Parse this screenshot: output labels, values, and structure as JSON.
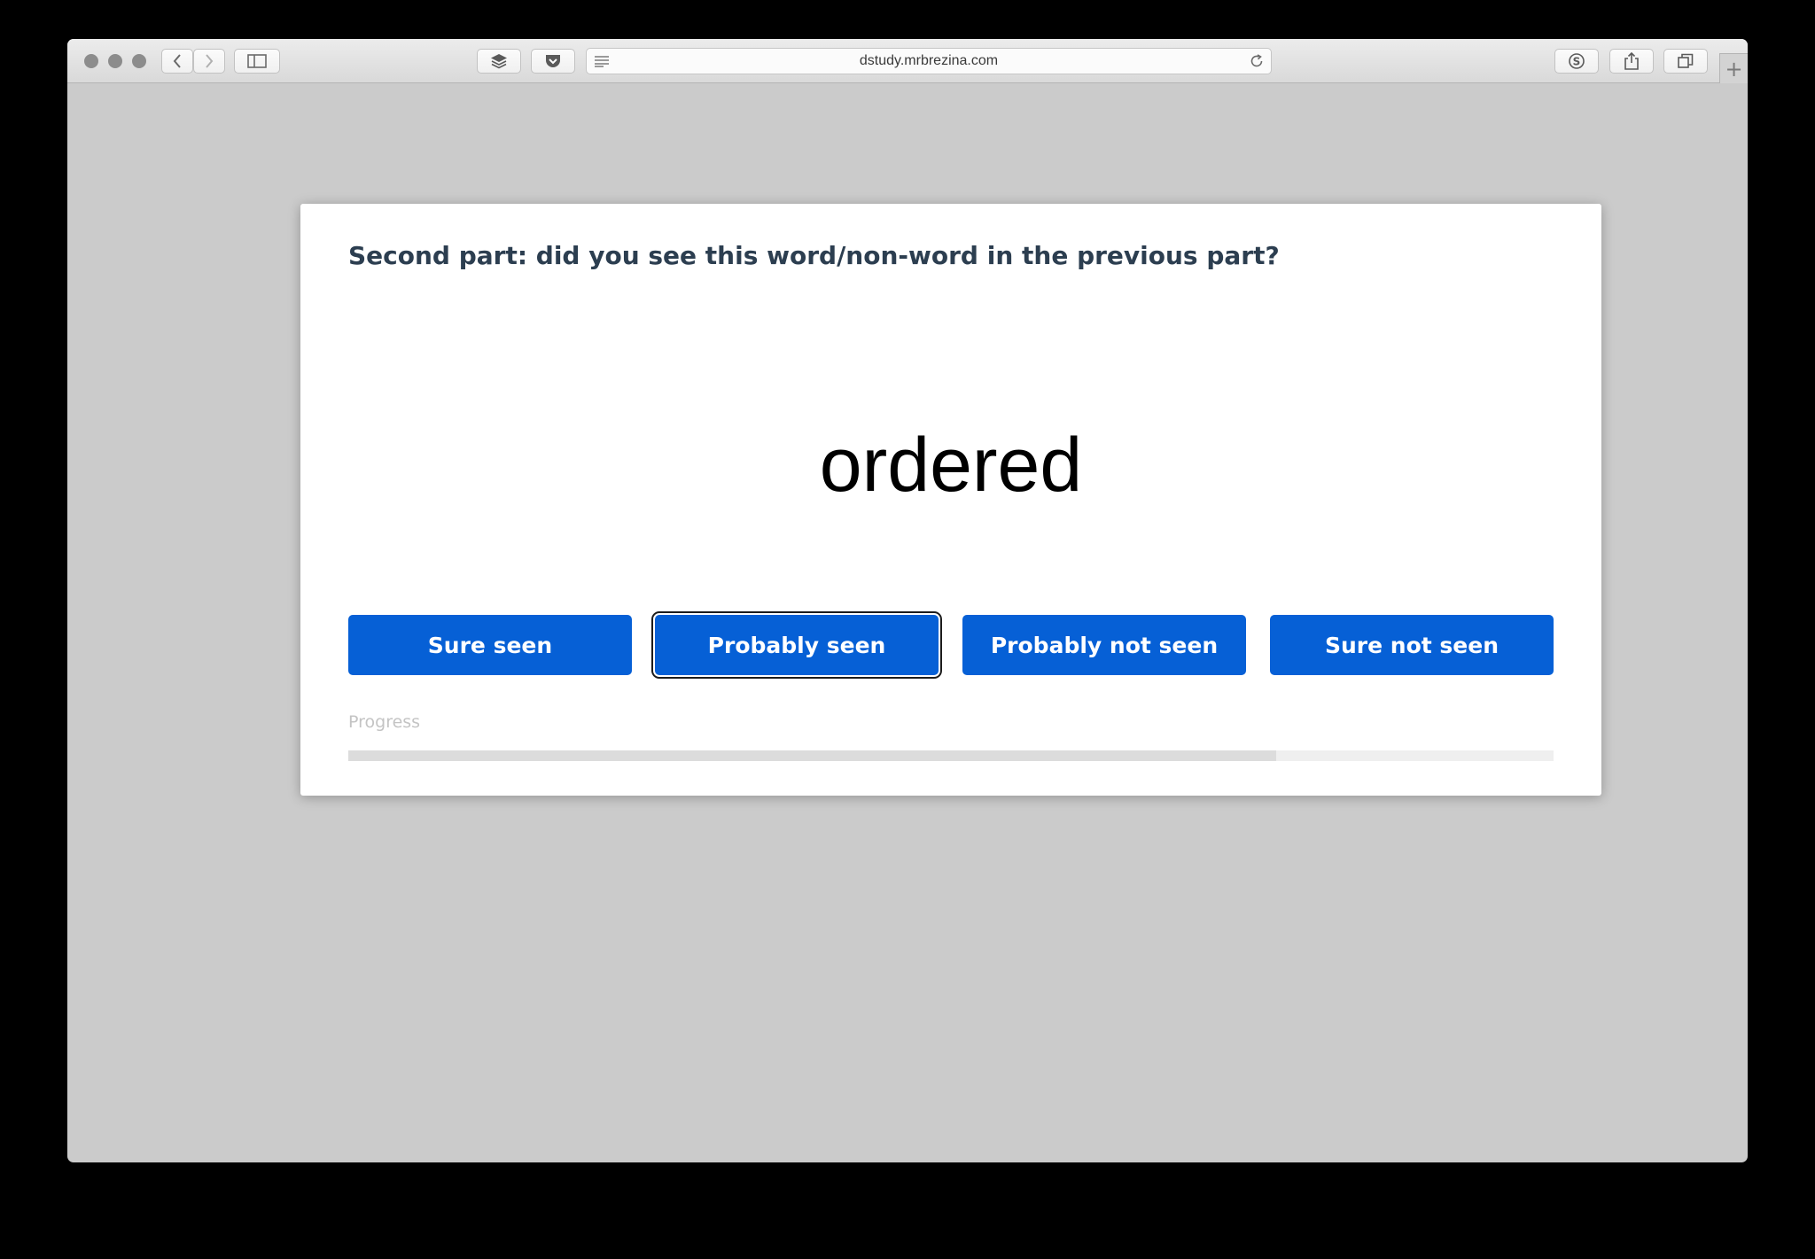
{
  "browser": {
    "url": "dstudy.mrbrezina.com",
    "toolbar_icons": [
      "back-icon",
      "forward-icon",
      "sidebar-icon",
      "layers-icon",
      "pocket-icon",
      "reader-icon",
      "reload-icon",
      "skype-icon",
      "share-icon",
      "tabs-icon",
      "new-tab-icon"
    ],
    "new_tab_glyph": "+"
  },
  "task": {
    "question": "Second part: did you see this word/non-word in the previous part?",
    "stimulus": "ordered",
    "choices": [
      {
        "label": "Sure seen",
        "focused": false
      },
      {
        "label": "Probably seen",
        "focused": true
      },
      {
        "label": "Probably not seen",
        "focused": false
      },
      {
        "label": "Sure not seen",
        "focused": false
      }
    ],
    "progress_label": "Progress",
    "progress_fraction": 0.77
  },
  "colors": {
    "button_bg": "#0660d6",
    "question_text": "#2c3e50",
    "page_bg": "#cbcbcb"
  }
}
